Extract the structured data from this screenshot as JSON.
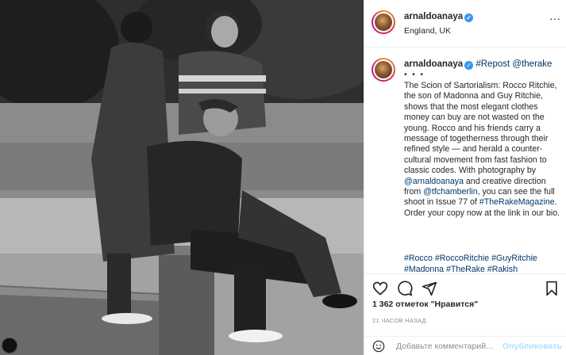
{
  "photo": {
    "description_icon": "photo-icon"
  },
  "header": {
    "username": "arnaldoanaya",
    "verified_glyph": "✓",
    "location": "England, UK",
    "more_glyph": "···"
  },
  "caption": {
    "username": "arnaldoanaya",
    "verified_glyph": "✓",
    "repost": "#Repost",
    "mention_source": "@therake",
    "dots": "• • •",
    "part1": "The Scion of Sartorialism: Rocco Ritchie, the son of Madonna and Guy Ritchie, shows that the most elegant clothes money can buy are not wasted on the young. Rocco and his friends carry a message of togetherness through their refined style — and herald a counter-cultural movement from fast fashion to classic codes. With photography by ",
    "mention_photo": "@arnaldoanaya",
    "part2": " and creative direction from ",
    "mention_creative": "@tfchamberlin",
    "part3": ", you can see the full shoot in Issue 77 of ",
    "hashtag_magazine": "#TheRakeMagazine",
    "part4": ". Order your copy now at the link in our bio.",
    "tags": "#Rocco #RoccoRitchie #GuyRitchie #Madonna #TheRake #Rakish"
  },
  "engagement": {
    "likes": "1 362 отметок \"Нравится\"",
    "timestamp": "21 ЧАСОВ НАЗАД"
  },
  "comment": {
    "placeholder": "Добавьте комментарий...",
    "publish": "Опубликовать"
  },
  "icons": {
    "like": "heart-icon",
    "comment": "comment-icon",
    "share": "share-icon",
    "save": "bookmark-icon",
    "emoji": "emoji-icon",
    "more": "more-icon"
  },
  "colors": {
    "link": "#00376b",
    "verified": "#3897f0",
    "publish_disabled": "#b2dffc",
    "muted": "#8e8e8e"
  }
}
